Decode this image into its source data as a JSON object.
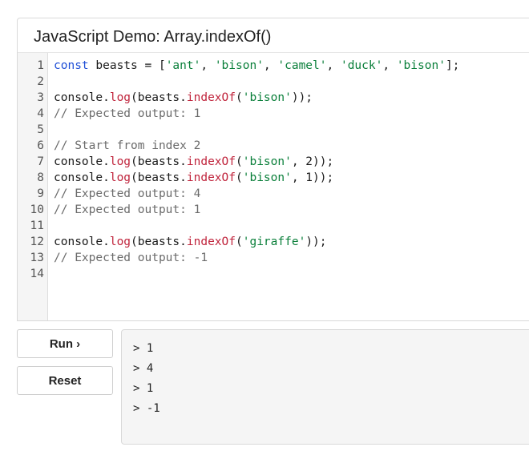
{
  "title": "JavaScript Demo: Array.indexOf()",
  "code_lines": [
    {
      "n": "1",
      "tokens": [
        {
          "t": "const",
          "c": "kw"
        },
        {
          "t": " beasts = [",
          "c": ""
        },
        {
          "t": "'ant'",
          "c": "str"
        },
        {
          "t": ", ",
          "c": ""
        },
        {
          "t": "'bison'",
          "c": "str"
        },
        {
          "t": ", ",
          "c": ""
        },
        {
          "t": "'camel'",
          "c": "str"
        },
        {
          "t": ", ",
          "c": ""
        },
        {
          "t": "'duck'",
          "c": "str"
        },
        {
          "t": ", ",
          "c": ""
        },
        {
          "t": "'bison'",
          "c": "str"
        },
        {
          "t": "];",
          "c": ""
        }
      ]
    },
    {
      "n": "2",
      "tokens": []
    },
    {
      "n": "3",
      "tokens": [
        {
          "t": "console.",
          "c": ""
        },
        {
          "t": "log",
          "c": "fn"
        },
        {
          "t": "(beasts.",
          "c": ""
        },
        {
          "t": "indexOf",
          "c": "fn"
        },
        {
          "t": "(",
          "c": ""
        },
        {
          "t": "'bison'",
          "c": "str"
        },
        {
          "t": "));",
          "c": ""
        }
      ]
    },
    {
      "n": "4",
      "tokens": [
        {
          "t": "// Expected output: 1",
          "c": "cm"
        }
      ]
    },
    {
      "n": "5",
      "tokens": []
    },
    {
      "n": "6",
      "tokens": [
        {
          "t": "// Start from index 2",
          "c": "cm"
        }
      ]
    },
    {
      "n": "7",
      "tokens": [
        {
          "t": "console.",
          "c": ""
        },
        {
          "t": "log",
          "c": "fn"
        },
        {
          "t": "(beasts.",
          "c": ""
        },
        {
          "t": "indexOf",
          "c": "fn"
        },
        {
          "t": "(",
          "c": ""
        },
        {
          "t": "'bison'",
          "c": "str"
        },
        {
          "t": ", 2));",
          "c": ""
        }
      ]
    },
    {
      "n": "8",
      "tokens": [
        {
          "t": "console.",
          "c": ""
        },
        {
          "t": "log",
          "c": "fn"
        },
        {
          "t": "(beasts.",
          "c": ""
        },
        {
          "t": "indexOf",
          "c": "fn"
        },
        {
          "t": "(",
          "c": ""
        },
        {
          "t": "'bison'",
          "c": "str"
        },
        {
          "t": ", 1));",
          "c": ""
        }
      ]
    },
    {
      "n": "9",
      "tokens": [
        {
          "t": "// Expected output: 4",
          "c": "cm"
        }
      ]
    },
    {
      "n": "10",
      "tokens": [
        {
          "t": "// Expected output: 1",
          "c": "cm"
        }
      ]
    },
    {
      "n": "11",
      "tokens": []
    },
    {
      "n": "12",
      "tokens": [
        {
          "t": "console.",
          "c": ""
        },
        {
          "t": "log",
          "c": "fn"
        },
        {
          "t": "(beasts.",
          "c": ""
        },
        {
          "t": "indexOf",
          "c": "fn"
        },
        {
          "t": "(",
          "c": ""
        },
        {
          "t": "'giraffe'",
          "c": "str"
        },
        {
          "t": "));",
          "c": ""
        }
      ]
    },
    {
      "n": "13",
      "tokens": [
        {
          "t": "// Expected output: -1",
          "c": "cm"
        }
      ]
    },
    {
      "n": "14",
      "tokens": []
    }
  ],
  "buttons": {
    "run_label": "Run ›",
    "reset_label": "Reset"
  },
  "output_lines": [
    "> 1",
    "> 4",
    "> 1",
    "> -1"
  ],
  "colors": {
    "keyword": "#1f4fd6",
    "string": "#0a7f3a",
    "function": "#c0243c",
    "comment": "#6b6b6b"
  }
}
